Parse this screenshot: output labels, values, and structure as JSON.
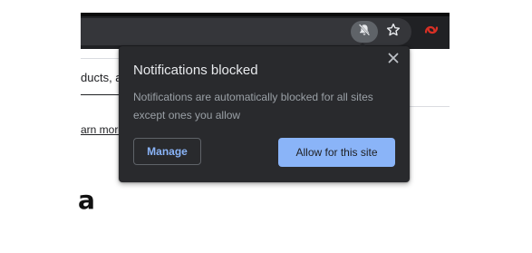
{
  "toolbar": {
    "icons": {
      "site_permission": "bell-off-icon",
      "bookmark": "star-icon",
      "extension": "extension-icon"
    }
  },
  "page": {
    "fragment_text": "ducts, a",
    "fragment_link": "arn more",
    "fragment_glyph": "a"
  },
  "popup": {
    "title": "Notifications blocked",
    "body": "Notifications are automatically blocked for all sites except ones you allow",
    "close_icon": "close-icon",
    "manage_label": "Manage",
    "allow_label": "Allow for this site"
  },
  "colors": {
    "popup_bg": "#292a2d",
    "accent": "#8ab4f8",
    "title_text": "#e8eaed",
    "body_text": "#9aa0a6"
  }
}
